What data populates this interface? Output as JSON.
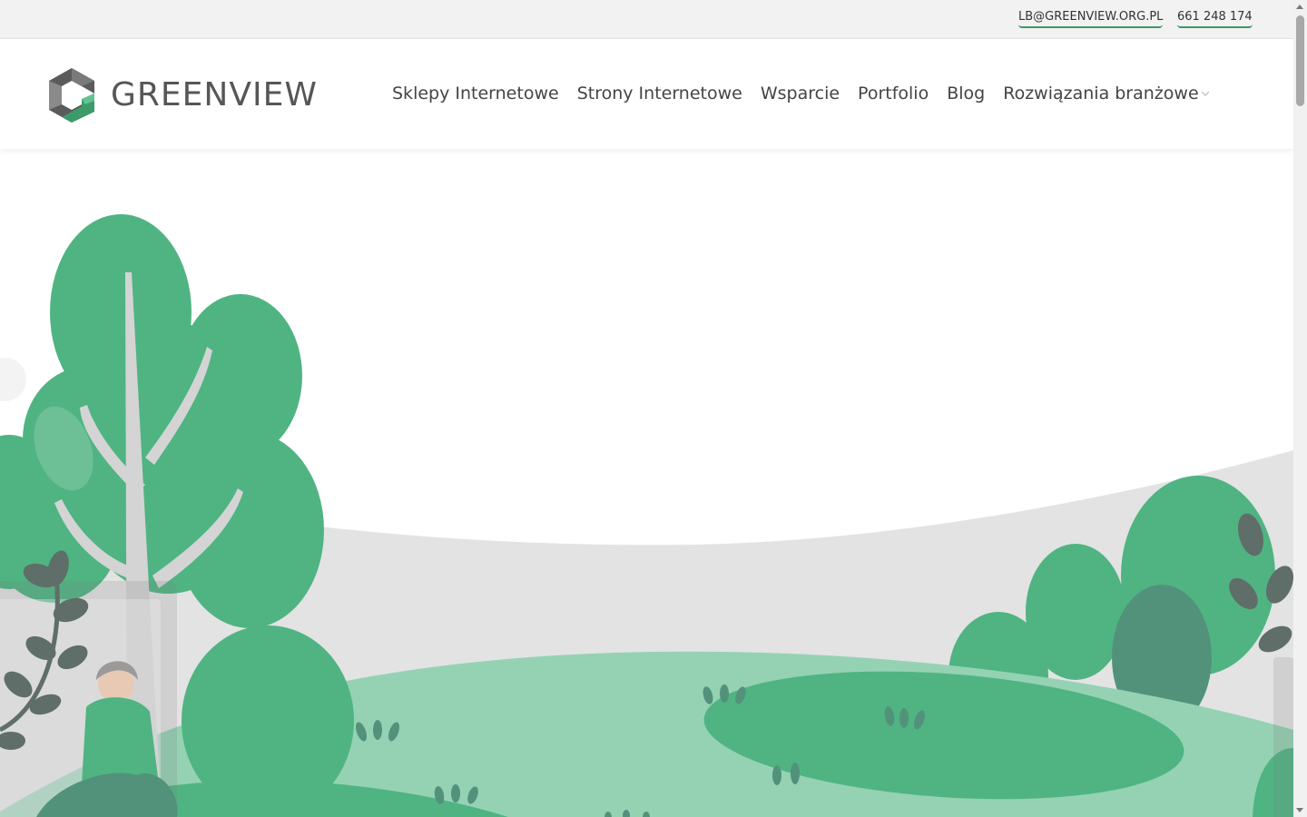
{
  "topbar": {
    "email": "LB@GREENVIEW.ORG.PL",
    "phone": "661 248 174"
  },
  "header": {
    "logo_text": "GREENVIEW",
    "nav": [
      {
        "label": "Sklepy Internetowe"
      },
      {
        "label": "Strony Internetowe"
      },
      {
        "label": "Wsparcie"
      },
      {
        "label": "Portfolio"
      },
      {
        "label": "Blog"
      },
      {
        "label": "Rozwiązania branżowe",
        "has_dropdown": true
      }
    ]
  },
  "colors": {
    "brand_green": "#3d9a6a",
    "tree_green": "#4fb482",
    "light_green": "#95d2b4",
    "dark_leaf": "#5f6e68",
    "hill_gray": "#e3e3e3"
  },
  "icons": {
    "logo": "greenview-hexagon-logo",
    "dropdown": "chevron-down-icon"
  }
}
